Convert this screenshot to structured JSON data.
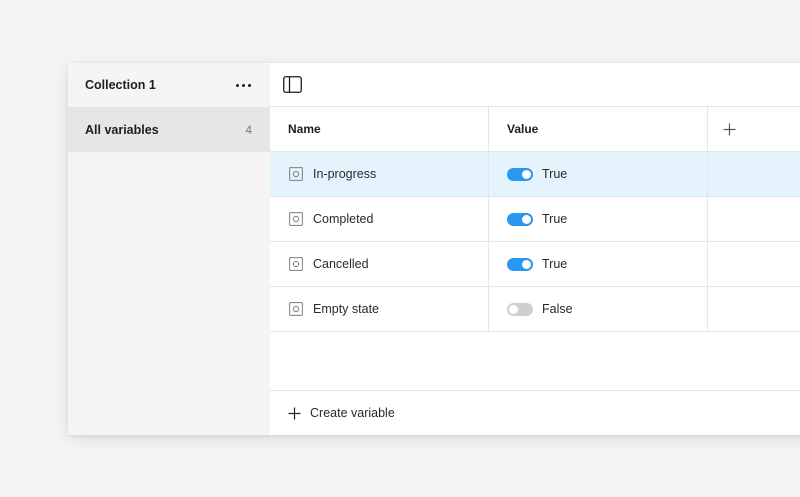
{
  "sidebar": {
    "collection_title": "Collection 1",
    "items": [
      {
        "label": "All variables",
        "count": "4"
      }
    ]
  },
  "table": {
    "columns": {
      "name": "Name",
      "value": "Value"
    },
    "rows": [
      {
        "name": "In-progress",
        "value_label": "True",
        "value": true,
        "selected": true
      },
      {
        "name": "Completed",
        "value_label": "True",
        "value": true,
        "selected": false
      },
      {
        "name": "Cancelled",
        "value_label": "True",
        "value": true,
        "selected": false
      },
      {
        "name": "Empty state",
        "value_label": "False",
        "value": false,
        "selected": false
      }
    ]
  },
  "footer": {
    "create_label": "Create variable"
  },
  "colors": {
    "toggle_on": "#2b97f0",
    "toggle_off": "#cfcfcf",
    "selected_row": "#e5f3fd"
  },
  "icons": {
    "more": "more-horizontal-icon",
    "sidebar_toggle": "sidebar-panel-icon",
    "add_column": "plus-icon",
    "variable": "boolean-variable-icon",
    "create": "plus-icon"
  }
}
